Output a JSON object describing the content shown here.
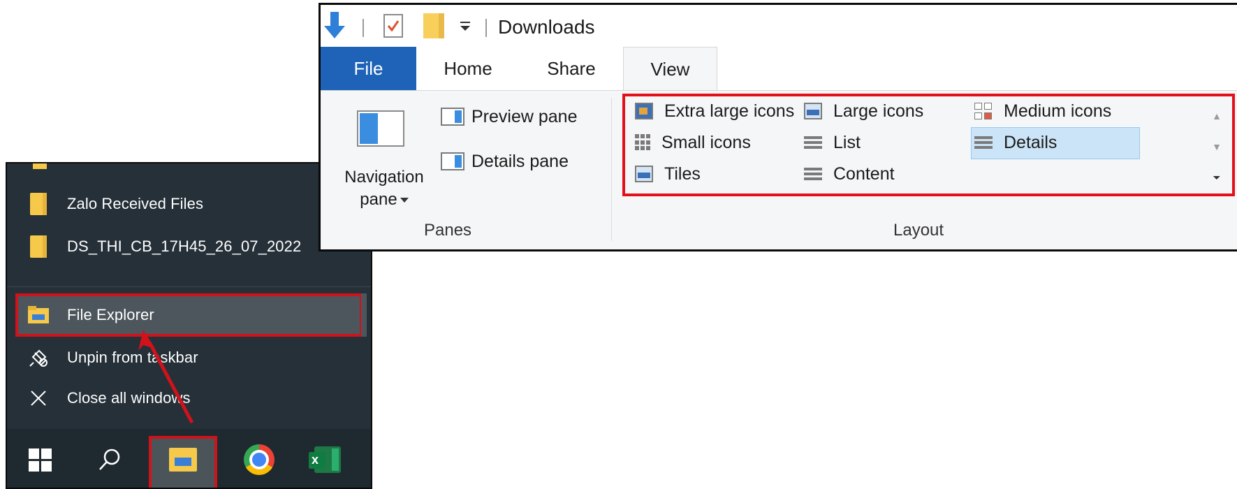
{
  "jumplist": {
    "recent_items": [
      {
        "label": "Zalo Received Files",
        "icon": "folder-icon"
      },
      {
        "label": "DS_THI_CB_17H45_26_07_2022",
        "icon": "folder-icon"
      }
    ],
    "tasks": [
      {
        "label": "File Explorer",
        "icon": "file-explorer-icon",
        "highlighted": true
      },
      {
        "label": "Unpin from taskbar",
        "icon": "unpin-icon"
      },
      {
        "label": "Close all windows",
        "icon": "close-icon"
      }
    ]
  },
  "taskbar": {
    "items": [
      "windows-start-icon",
      "search-icon",
      "file-explorer-icon",
      "chrome-icon",
      "excel-icon"
    ],
    "active": "file-explorer-icon"
  },
  "explorer": {
    "title": "Downloads",
    "tabs": [
      {
        "label": "File"
      },
      {
        "label": "Home"
      },
      {
        "label": "Share"
      },
      {
        "label": "View",
        "selected": true
      }
    ],
    "panes": {
      "navigation_pane_line1": "Navigation",
      "navigation_pane_line2": "pane",
      "preview_pane": "Preview pane",
      "details_pane": "Details pane",
      "group_label": "Panes"
    },
    "layout": {
      "items": [
        "Extra large icons",
        "Large icons",
        "Medium icons",
        "Small icons",
        "List",
        "Details",
        "Tiles",
        "Content"
      ],
      "selected": "Details",
      "group_label": "Layout"
    }
  },
  "colors": {
    "highlight_red": "#e3101b",
    "file_tab_blue": "#1e63b7",
    "jumplist_bg": "#253038"
  }
}
